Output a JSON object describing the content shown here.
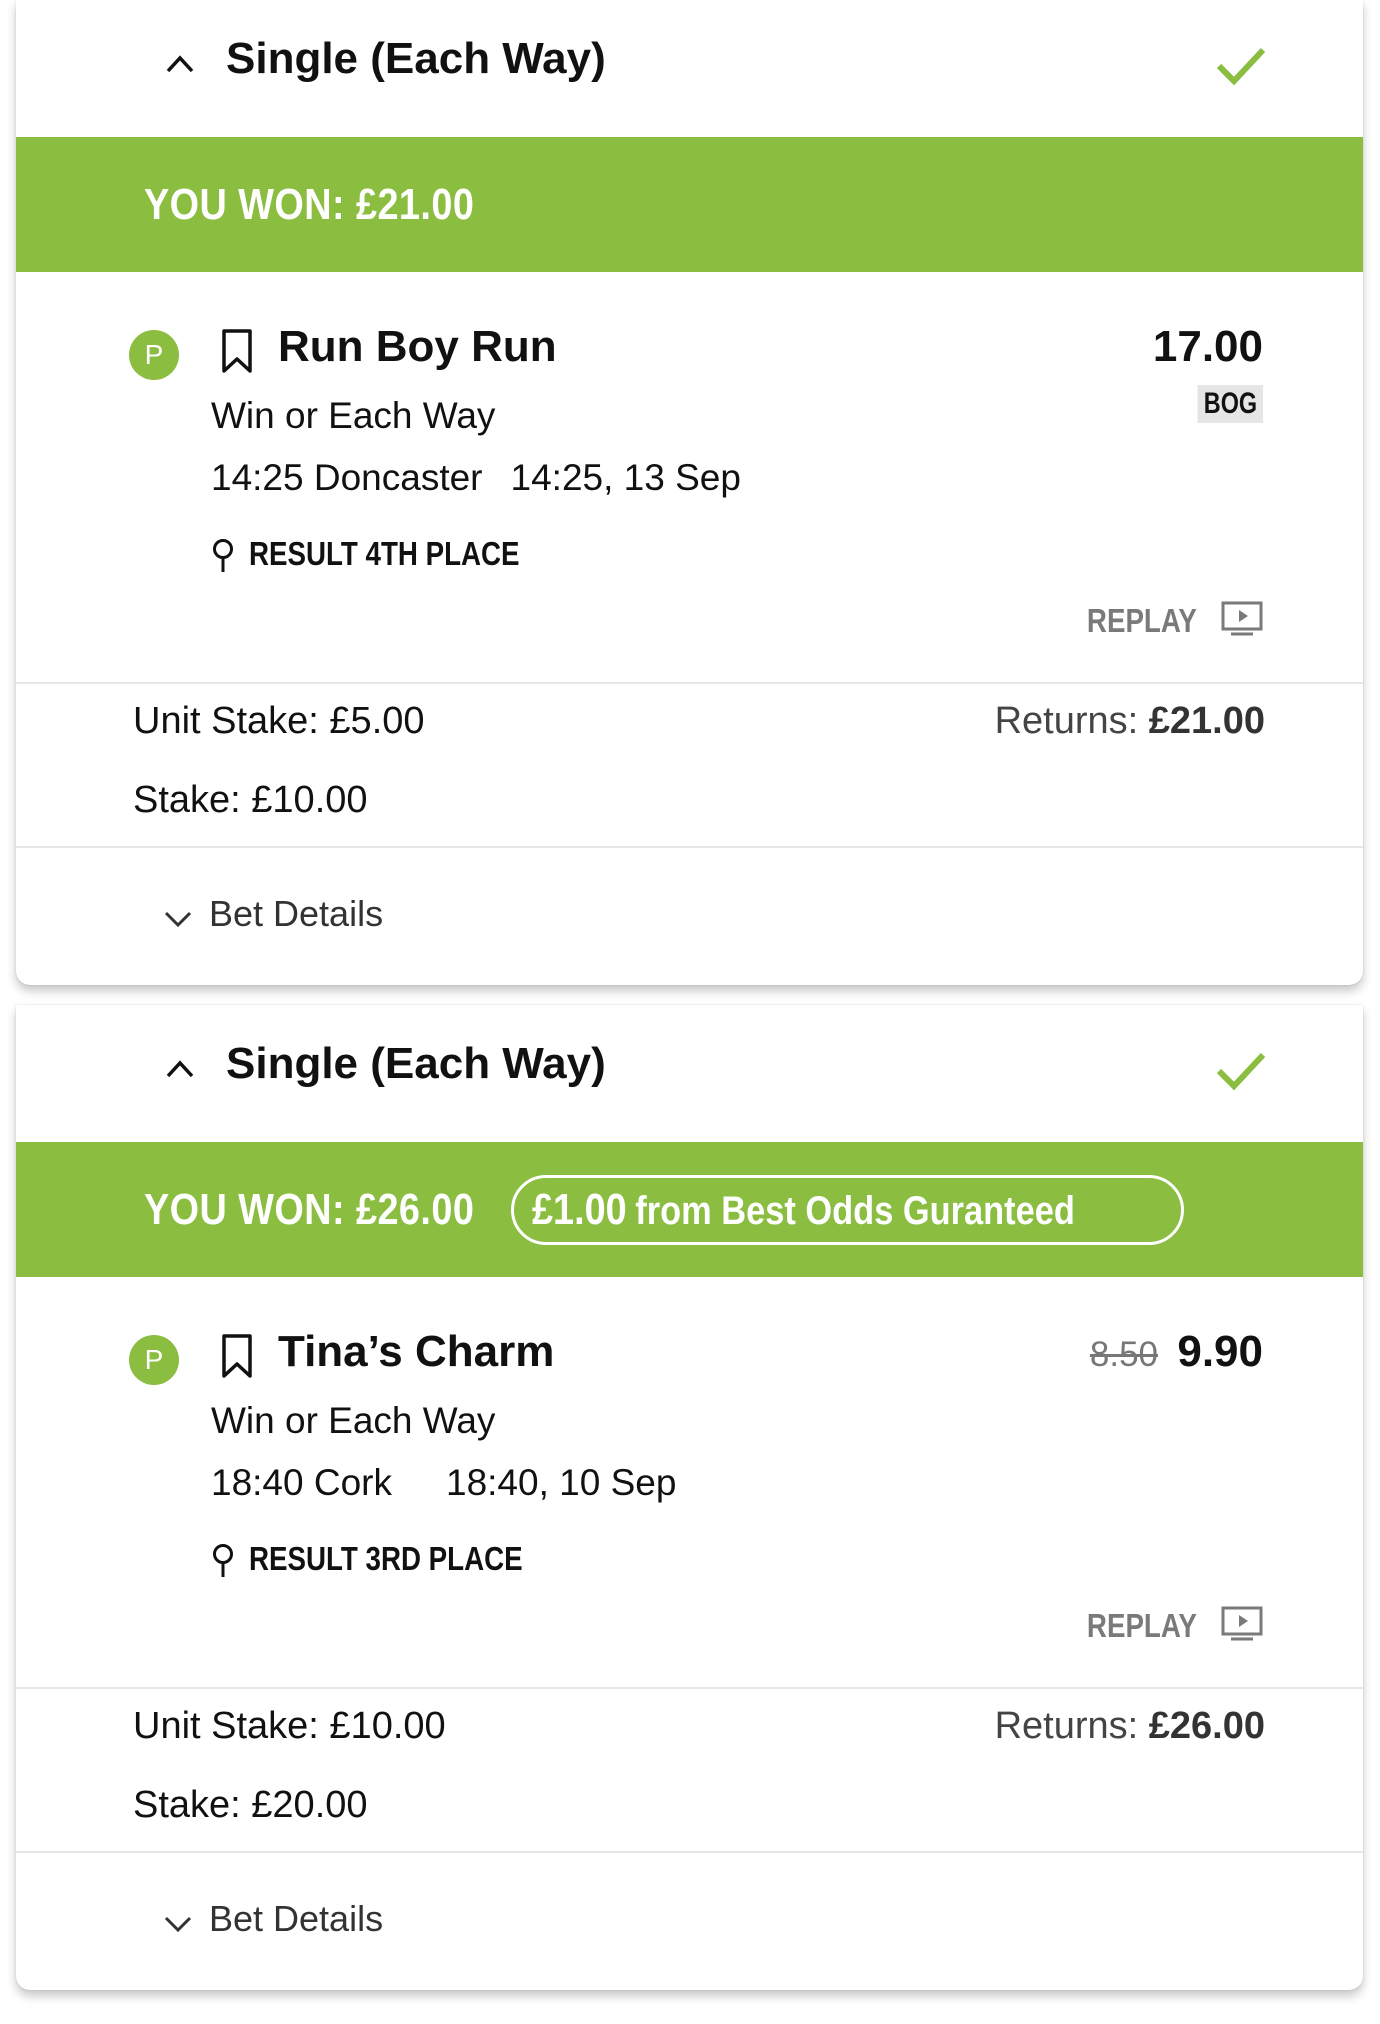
{
  "bets": [
    {
      "bet_type": "Single (Each Way)",
      "won_label": "YOU WON: £21.00",
      "bog_amount": "",
      "bog_text": "",
      "selection": {
        "status_badge": "P",
        "name": "Run Boy Run",
        "market": "Win or Each Way",
        "event": "14:25 Doncaster",
        "event_time": "14:25, 13 Sep",
        "result": "RESULT 4TH PLACE",
        "old_odds": "",
        "odds": "17.00",
        "odds_tag": "BOG",
        "replay_label": "REPLAY"
      },
      "unit_stake": "Unit Stake: £5.00",
      "stake": "Stake: £10.00",
      "returns_label": "Returns: ",
      "returns_value": "£21.00",
      "details_label": "Bet Details"
    },
    {
      "bet_type": "Single (Each Way)",
      "won_label": "YOU WON: £26.00",
      "bog_amount": "£1.00",
      "bog_text": "from Best Odds Guranteed",
      "selection": {
        "status_badge": "P",
        "name": "Tina’s Charm",
        "market": "Win or Each Way",
        "event": "18:40 Cork",
        "event_time": "18:40, 10 Sep",
        "result": "RESULT 3RD PLACE",
        "old_odds": "8.50",
        "odds": "9.90",
        "odds_tag": "",
        "replay_label": "REPLAY"
      },
      "unit_stake": "Unit Stake: £10.00",
      "stake": "Stake: £20.00",
      "returns_label": "Returns: ",
      "returns_value": "£26.00",
      "details_label": "Bet Details"
    }
  ],
  "colors": {
    "accent_green": "#8abd40",
    "text_dark": "#111111",
    "muted": "#7a7a7a"
  }
}
